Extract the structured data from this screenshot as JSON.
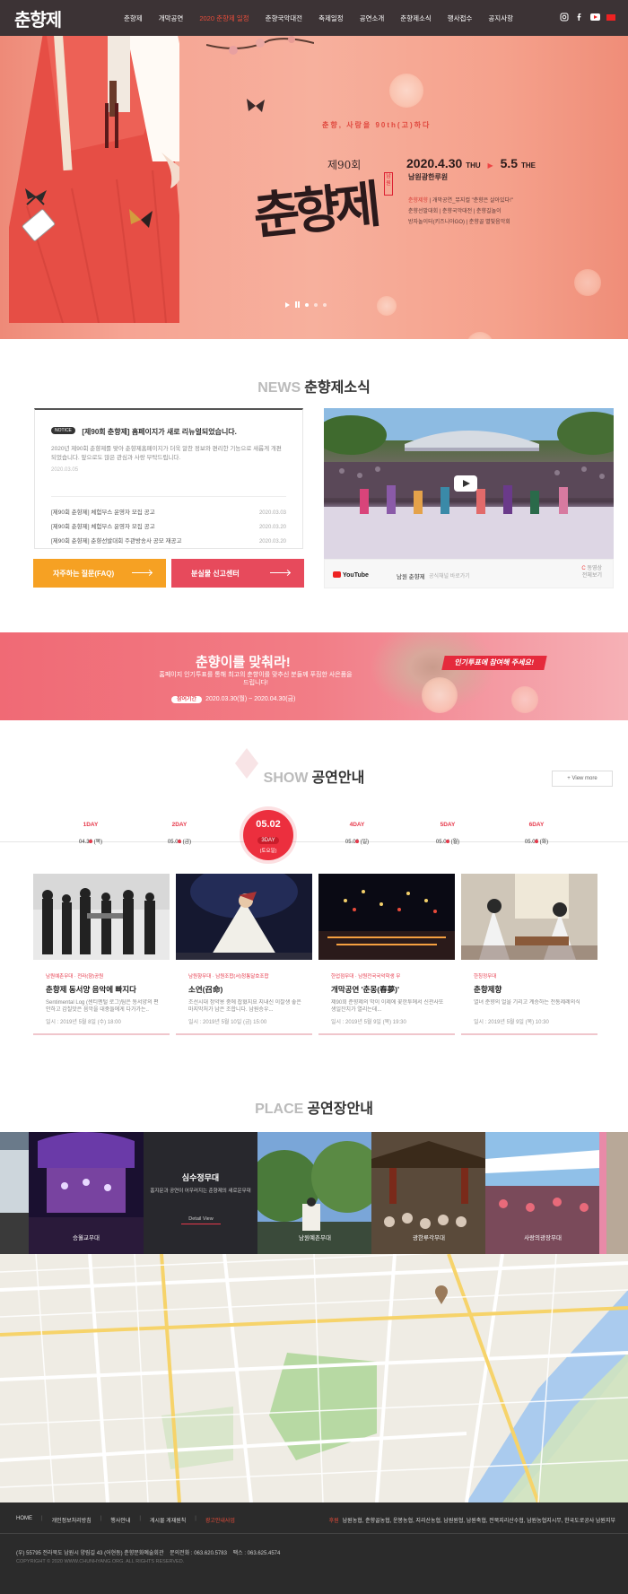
{
  "header": {
    "logo_text": "춘향제",
    "nav": [
      "춘향제",
      "개막공연",
      "2020 춘향제 일정",
      "춘향국악대전",
      "축제일정",
      "공연소개",
      "춘향제소식",
      "행사접수",
      "공지사항"
    ],
    "sns": [
      "instagram-icon",
      "facebook-icon",
      "youtube-icon",
      "language-icon"
    ]
  },
  "hero": {
    "copy": "춘향, 사랑을 90th(고)하다",
    "edition": "제90회",
    "title": "춘향제",
    "seal": "남원",
    "date_start": "2020.4.30",
    "date_start_day": "THU",
    "date_end": "5.5",
    "date_end_day": "THE",
    "sponsor": "남원광한루원",
    "events": [
      {
        "hl": "춘향제향",
        "rest": " | 개막공연_뮤지컬 \"춘향은 살아있다!\""
      },
      {
        "hl": "",
        "rest": "춘향선발대회 | 춘향국악대전 | 춘향길놀이"
      },
      {
        "hl": "",
        "rest": "방자놀이터(키즈니아GO) | 춘향골 별빛음악회"
      }
    ]
  },
  "news": {
    "title_en": "NEWS",
    "title_ko": "춘향제소식",
    "notice_tag": "NOTICE",
    "notice_title": "[제90회 춘향제] 홈페이지가 새로 리뉴얼되었습니다.",
    "notice_desc": "2020년 제90회 춘향제를 맞아 춘향제홈페이지가 더욱 알찬 정보와 편리한 기능으로 새롭게 개편되었습니다. 앞으로도 많은 관심과 사랑 부탁드립니다.",
    "notice_date": "2020.03.05",
    "list": [
      {
        "title": "[제90회 춘향제] 체험부스 운영자 모집 공고",
        "date": "2020.03.03"
      },
      {
        "title": "[제90회 춘향제] 체험부스 운영자 모집 공고",
        "date": "2020.03.20"
      },
      {
        "title": "[제90회 춘향제] 춘향선발대회 주관방송사 공모 재공고",
        "date": "2020.03.20"
      }
    ],
    "faq_label": "자주하는 질문(FAQ)",
    "lost_label": "분실물 신고센터"
  },
  "video": {
    "platform": "YouTube",
    "channel": "남원 춘향제",
    "sub": "공식채널 바로가기",
    "more_1": "동영상",
    "more_2": "전체보기"
  },
  "banner": {
    "title": "춘향이를 맞춰라!",
    "desc": "홈페이지 인기투표를 통해 최고의 춘향이를 맞추신 분들께 푸짐한 사은품을 드립니다!",
    "period_label": "참여기간",
    "period": "2020.03.30(월) ~ 2020.04.30(금)",
    "button": "인기투표에 참여해 주세요!"
  },
  "show": {
    "title_en": "SHOW",
    "title_ko": "공연안내",
    "view_more": "+ View more",
    "days": [
      {
        "label": "1DAY",
        "date": "04.30 (목)"
      },
      {
        "label": "2DAY",
        "date": "05.01 (금)"
      },
      {
        "label": "4DAY",
        "date": "05.03 (일)"
      },
      {
        "label": "5DAY",
        "date": "05.04 (월)"
      },
      {
        "label": "6DAY",
        "date": "05.05 (화)"
      }
    ],
    "active_day": {
      "date": "05.02",
      "label": "3DAY",
      "day": "(토요일)"
    },
    "cards": [
      {
        "cat": "남원예촌무대 · 전라(향)공원",
        "title": "춘향제 동서양 음악에 빠지다",
        "desc": "Sentimental Log (센티멘털 로그)팀은 동서양의 편안하고 감칠맛은 음악을 대중들에게 다가가는..",
        "date": "일시 : 2019년 5월 8일 (수) 18:00"
      },
      {
        "cat": "남원향무대 · 남원조합(서)청통달호조합",
        "title": "소연(召命)",
        "desc": "조선시대 정약용 중에 잡혔지요 지내신 이잘생 좋은 마지막처가 남은 조합니다. 남원승우...",
        "date": "일시 : 2019년 5월 10일 (금) 15:00"
      },
      {
        "cat": "한업점무대 · 남원전국국악학생 무",
        "title": "개막공연 '춘몽(春夢)'",
        "desc": "제90회 춘향제의 막이 이제에 꽃한투에서 신관사또 생일잔치가 열리는데...",
        "date": "일시 : 2019년 5월 9일 (목) 19:30"
      },
      {
        "cat": "한칭정무대",
        "title": "춘향제향",
        "desc": "열녀 춘향의 얼을 기리고 계승하는 전통제례의식",
        "date": "일시 : 2019년 5월 9일 (목) 10:30"
      }
    ]
  },
  "place": {
    "title_en": "PLACE",
    "title_ko": "공연장안내",
    "items": [
      "승월교무대",
      "남원예촌무대",
      "광한루각무대",
      "사랑의광장무대"
    ],
    "active": {
      "name": "심수정무대",
      "desc": "홈지문과 공연이 어우러지는 춘향제의 새로운무대",
      "btn": "Detail View"
    }
  },
  "footer": {
    "nav": [
      "HOME",
      "개인정보처리방침",
      "행사안내",
      "게시물 게재원칙",
      "광고안내사업"
    ],
    "sponsor_label": "후원",
    "sponsors": "남원농협, 춘향골농협, 운봉농협, 지리산농협, 남원원협, 남원축협, 전북지리산수협, 남원농협지시무, 한국도로공사 남원지부",
    "address": "(우) 55795 전라북도 남원시 양림길 43 (어현동) 춘향문화예술회관",
    "tel_label": "문의전화 : 063.620.5783",
    "fax_label": "팩스 : 063.625.4574",
    "copyright": "COPYRIGHT © 2020 WWW.CHUNHYANG.ORG. ALL RIGHTS RESERVED."
  },
  "colors": {
    "accent": "#e6394b",
    "header": "#2d2326",
    "hero": "#f6a493",
    "faq": "#f6a123",
    "lost": "#e74a5c"
  }
}
